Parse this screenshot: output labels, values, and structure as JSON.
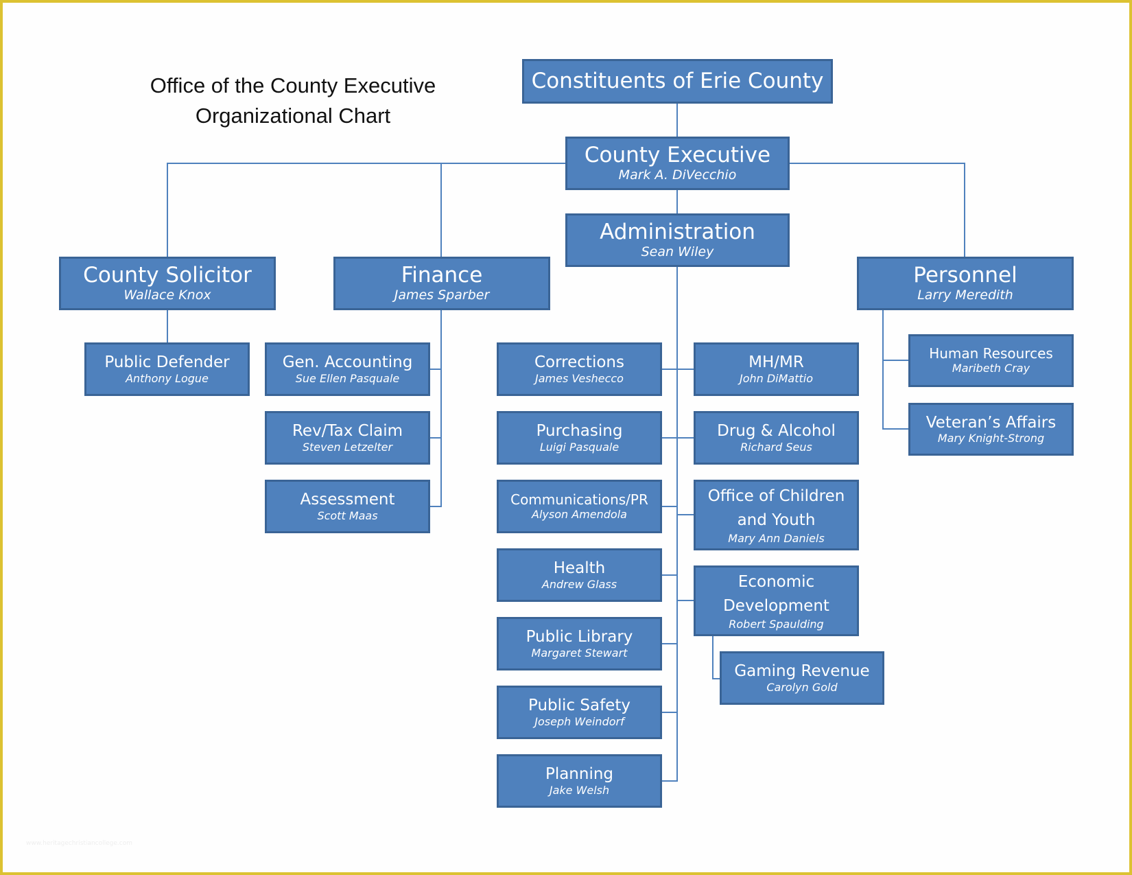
{
  "title": {
    "line1": "Office of the County Executive",
    "line2": "Organizational Chart"
  },
  "colors": {
    "box_fill": "#4f81bd",
    "box_border": "#3a6496",
    "connector": "#4f81bd",
    "page_border": "#dcc232"
  },
  "watermark": "www.heritagechristiancollege.com",
  "nodes": {
    "constituents": {
      "title": "Constituents of Erie County"
    },
    "county_executive": {
      "title": "County Executive",
      "person": "Mark A. DiVecchio"
    },
    "administration": {
      "title": "Administration",
      "person": "Sean Wiley"
    },
    "county_solicitor": {
      "title": "County Solicitor",
      "person": "Wallace Knox"
    },
    "finance": {
      "title": "Finance",
      "person": "James Sparber"
    },
    "personnel": {
      "title": "Personnel",
      "person": "Larry Meredith"
    },
    "public_defender": {
      "title": "Public Defender",
      "person": "Anthony Logue"
    },
    "gen_accounting": {
      "title": "Gen. Accounting",
      "person": "Sue Ellen Pasquale"
    },
    "rev_tax_claim": {
      "title": "Rev/Tax Claim",
      "person": "Steven Letzelter"
    },
    "assessment": {
      "title": "Assessment",
      "person": "Scott Maas"
    },
    "corrections": {
      "title": "Corrections",
      "person": "James Veshecco"
    },
    "purchasing": {
      "title": "Purchasing",
      "person": "Luigi Pasquale"
    },
    "communications_pr": {
      "title": "Communications/PR",
      "person": "Alyson Amendola"
    },
    "health": {
      "title": "Health",
      "person": "Andrew Glass"
    },
    "public_library": {
      "title": "Public Library",
      "person": "Margaret Stewart"
    },
    "public_safety": {
      "title": "Public Safety",
      "person": "Joseph Weindorf"
    },
    "planning": {
      "title": "Planning",
      "person": "Jake Welsh"
    },
    "mh_mr": {
      "title": "MH/MR",
      "person": "John DiMattio"
    },
    "drug_alcohol": {
      "title": "Drug & Alcohol",
      "person": "Richard Seus"
    },
    "children_youth": {
      "title": "Office of Children and Youth",
      "person": "Mary Ann Daniels"
    },
    "economic_development": {
      "title": "Economic Development",
      "person": "Robert Spaulding"
    },
    "gaming_revenue": {
      "title": "Gaming Revenue",
      "person": "Carolyn Gold"
    },
    "human_resources": {
      "title": "Human Resources",
      "person": "Maribeth Cray"
    },
    "veterans_affairs": {
      "title": "Veteran’s Affairs",
      "person": "Mary Knight-Strong"
    }
  },
  "hierarchy": {
    "constituents": [
      "county_executive"
    ],
    "county_executive": [
      "administration",
      "county_solicitor",
      "finance",
      "personnel"
    ],
    "county_solicitor": [
      "public_defender"
    ],
    "finance": [
      "gen_accounting",
      "rev_tax_claim",
      "assessment"
    ],
    "administration": [
      "corrections",
      "purchasing",
      "communications_pr",
      "health",
      "public_library",
      "public_safety",
      "planning",
      "mh_mr",
      "drug_alcohol",
      "children_youth",
      "economic_development"
    ],
    "economic_development": [
      "gaming_revenue"
    ],
    "personnel": [
      "human_resources",
      "veterans_affairs"
    ]
  }
}
